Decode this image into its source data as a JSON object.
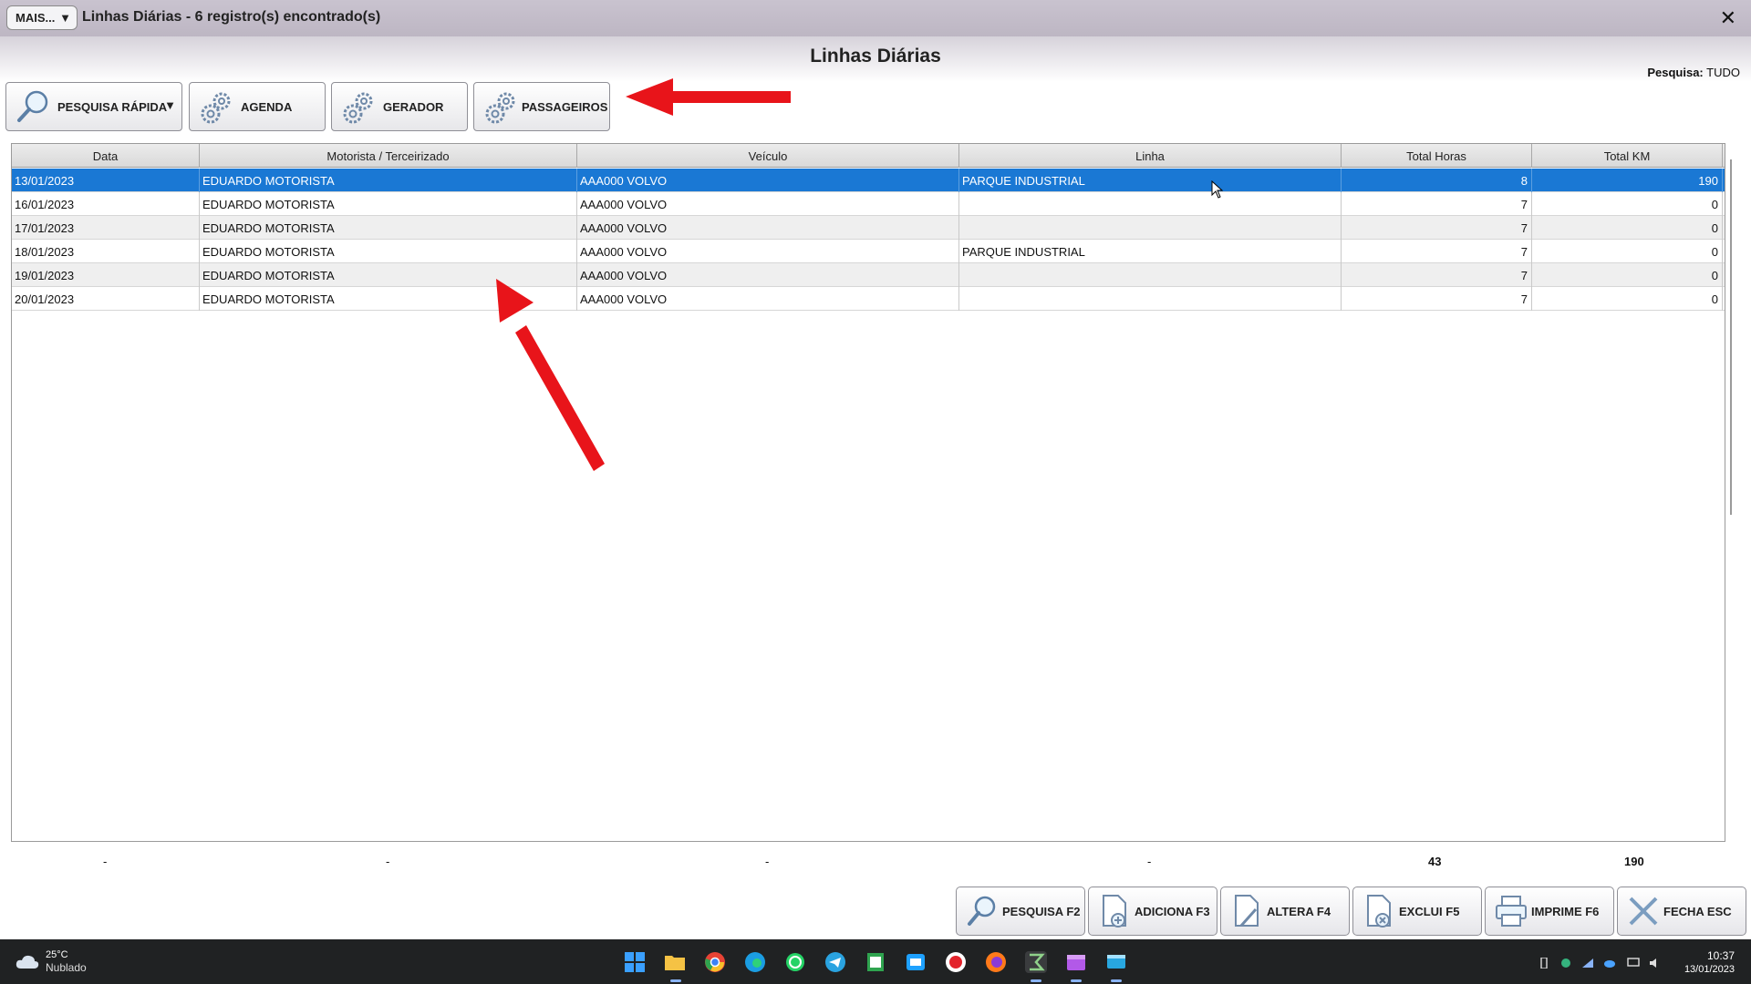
{
  "window": {
    "mais_label": "MAIS...",
    "mais_arrow": "▼",
    "title": "Linhas Diárias - 6 registro(s) encontrado(s)",
    "close_glyph": "✕"
  },
  "page": {
    "title": "Linhas Diárias",
    "pesquisa_key": "Pesquisa:",
    "pesquisa_value": "TUDO"
  },
  "toolbar": {
    "pesquisa_rapida": "PESQUISA RÁPIDA",
    "dropdown_arrow": "▼",
    "agenda": "AGENDA",
    "gerador": "GERADOR",
    "passageiros": "PASSAGEIROS"
  },
  "table": {
    "columns": [
      "Data",
      "Motorista / Terceirizado",
      "Veículo",
      "Linha",
      "Total Horas",
      "Total KM"
    ],
    "rows": [
      {
        "data": "13/01/2023",
        "motorista": "EDUARDO MOTORISTA",
        "veiculo": "AAA000 VOLVO",
        "linha": "PARQUE INDUSTRIAL",
        "horas": "8",
        "km": "190"
      },
      {
        "data": "16/01/2023",
        "motorista": "EDUARDO MOTORISTA",
        "veiculo": "AAA000 VOLVO",
        "linha": "",
        "horas": "7",
        "km": "0"
      },
      {
        "data": "17/01/2023",
        "motorista": "EDUARDO MOTORISTA",
        "veiculo": "AAA000 VOLVO",
        "linha": "",
        "horas": "7",
        "km": "0"
      },
      {
        "data": "18/01/2023",
        "motorista": "EDUARDO MOTORISTA",
        "veiculo": "AAA000 VOLVO",
        "linha": "PARQUE INDUSTRIAL",
        "horas": "7",
        "km": "0"
      },
      {
        "data": "19/01/2023",
        "motorista": "EDUARDO MOTORISTA",
        "veiculo": "AAA000 VOLVO",
        "linha": "",
        "horas": "7",
        "km": "0"
      },
      {
        "data": "20/01/2023",
        "motorista": "EDUARDO MOTORISTA",
        "veiculo": "AAA000 VOLVO",
        "linha": "",
        "horas": "7",
        "km": "0"
      }
    ],
    "selected_row": 0
  },
  "totals": {
    "data": "-",
    "motorista": "-",
    "veiculo": "-",
    "linha": "-",
    "horas": "43",
    "km": "190"
  },
  "actions": {
    "pesquisa": "PESQUISA F2",
    "adiciona": "ADICIONA F3",
    "altera": "ALTERA F4",
    "exclui": "EXCLUI F5",
    "imprime": "IMPRIME F6",
    "fecha": "FECHA ESC"
  },
  "taskbar": {
    "temperature": "25°C",
    "weather": "Nublado",
    "time": "10:37",
    "date": "13/01/2023"
  },
  "colors": {
    "selection": "#1a78d4",
    "annotation_arrow": "#e8141a"
  }
}
